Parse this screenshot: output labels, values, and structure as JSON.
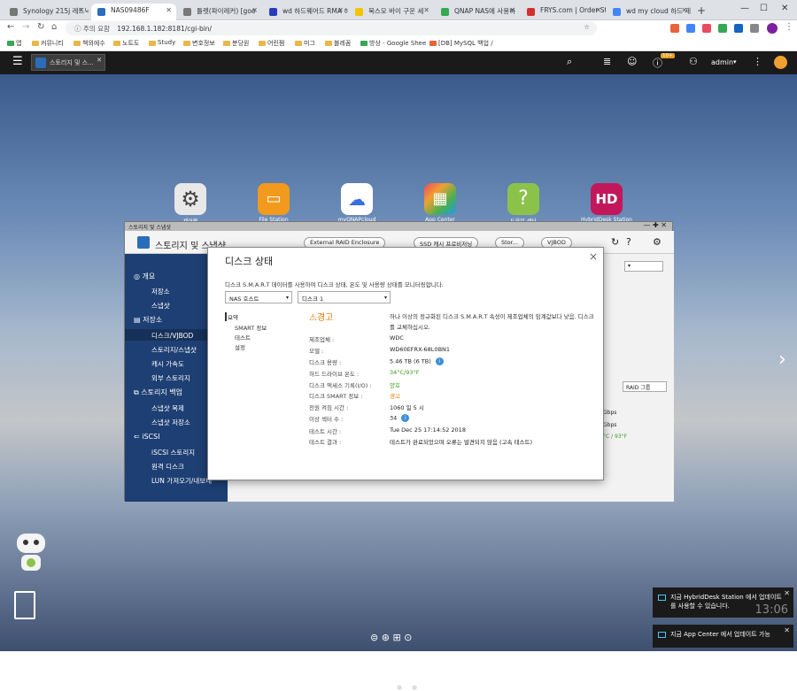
{
  "browser": {
    "tabs": [
      {
        "label": "Synology 215j 레드닉",
        "color": "#777"
      },
      {
        "label": "NAS09486F",
        "color": "#2a6ebb"
      },
      {
        "label": "틀렛(파이레커) [goo",
        "color": "#777"
      },
      {
        "label": "wd 하드웨어드 RMA 하",
        "color": "#2a3cbb"
      },
      {
        "label": "북스모 바이 구운 세",
        "color": "#f5c400"
      },
      {
        "label": "QNAP NAS에 사용하",
        "color": "#34a853"
      },
      {
        "label": "FRYS.com | Order Sta",
        "color": "#d32f2f"
      },
      {
        "label": "wd my cloud 하드 제",
        "color": "#4285f4"
      }
    ],
    "address": {
      "security": "주의 요함",
      "url": "192.168.1.182:8181/cgi-bin/"
    },
    "bookmarks": [
      "앱",
      "커뮤니티",
      "책외에수",
      "노트도",
      "Study",
      "변호정보",
      "분당원",
      "어린쩜",
      "미그",
      "블레꼼",
      "방상 - Google Shee",
      "[DB] MySQL 백업 / "
    ]
  },
  "qts": {
    "taskbar_app": "스토리지 및 스...",
    "user": "admin",
    "badge": "10+"
  },
  "desktop": {
    "apps": [
      {
        "label": "제어판",
        "color": "#e8e8e8"
      },
      {
        "label": "File Station",
        "color": "#f29a1e"
      },
      {
        "label": "myQNAPcloud",
        "color": "#ffffff"
      },
      {
        "label": "App Center",
        "color": "#e84a5f"
      },
      {
        "label": "도움말 센터",
        "color": "#8bc34a"
      },
      {
        "label": "HybridDesk Station",
        "color": "#c2185b"
      }
    ]
  },
  "storage_window": {
    "title": "스토리지 및 스냅샷",
    "header_title": "스토리지 및 스냅샷",
    "toolbar": [
      "External RAID Enclosure",
      "SSD 캐시 프로비저닝",
      "Stor...",
      "VJBOD"
    ],
    "sidebar": [
      {
        "label": "개요",
        "section": true
      },
      {
        "label": "저장소",
        "section": false
      },
      {
        "label": "스냅샷",
        "section": false
      },
      {
        "label": "저장소",
        "section": true
      },
      {
        "label": "디스크/VJBOD",
        "section": false
      },
      {
        "label": "스토리지/스냅샷",
        "section": false
      },
      {
        "label": "캐시 가속도",
        "section": false
      },
      {
        "label": "외부 스토리지",
        "section": false
      },
      {
        "label": "스토리지 백업",
        "section": true
      },
      {
        "label": "스냅샷 복제",
        "section": false
      },
      {
        "label": "스냅샷 저장소",
        "section": false
      },
      {
        "label": "iSCSI",
        "section": true
      },
      {
        "label": "iSCSI 스토리지",
        "section": false
      },
      {
        "label": "원격 디스크",
        "section": false
      },
      {
        "label": "LUN 가져오기/내보내",
        "section": false
      }
    ],
    "raid_select": "RAID 그룹",
    "stats": [
      "Gbps",
      "Gbps"
    ],
    "temp": "°C / 93°F"
  },
  "disk_dialog": {
    "title": "디스크 상태",
    "description": "디스크 S.M.A.R.T 데이터를 사용하여 디스크 상태, 온도 및 사용량 상태를 모니터링합니다.",
    "select_host": "NAS 호스트",
    "select_disk": "디스크 1",
    "nav": [
      "요약",
      "SMART 정보",
      "테스트",
      "설정"
    ],
    "status": "경고",
    "status_color": "#e07a00",
    "warning_text": "하나 이상의 정규화된 디스크 S.M.A.R.T 속성이 제조업체의 임계값보다 낮음. 디스크를 교체하십시오.",
    "fields": [
      {
        "label": "제조업체 :",
        "value": "WDC",
        "color": "#222",
        "info": false
      },
      {
        "label": "모델 :",
        "value": "WD60EFRX-68L0BN1",
        "color": "#222",
        "info": false
      },
      {
        "label": "디스크 용량 :",
        "value": "5.46 TB (6 TB)",
        "color": "#222",
        "info": true
      },
      {
        "label": "하드 드라이브 온도 :",
        "value": "34°C/93°F",
        "color": "#3c9a1a",
        "info": false
      },
      {
        "label": "디스크 액세스 기록(I/O) :",
        "value": "양호",
        "color": "#3c9a1a",
        "info": false
      },
      {
        "label": "디스크 SMART 정보 :",
        "value": "경고",
        "color": "#e07a00",
        "info": false
      },
      {
        "label": "전원 켜짐 시간 :",
        "value": "1060 일 5 시",
        "color": "#222",
        "info": false
      },
      {
        "label": "이상 섹터 수 :",
        "value": "34",
        "color": "#222",
        "info": true
      },
      {
        "label": "테스트 시간 :",
        "value": "Tue Dec 25 17:14:52 2018",
        "color": "#222",
        "info": false
      },
      {
        "label": "테스트 결과 :",
        "value": "테스트가 완료되었으며 오류는 발견되지 않음 (고속 테스트)",
        "color": "#222",
        "info": false
      }
    ]
  },
  "notifications": [
    "지금 HybridDesk Station 에서 업데이트 를 사용할 수 있습니다.",
    "지금 App Center 에서 업데이트 가능"
  ],
  "clock": "13:06"
}
